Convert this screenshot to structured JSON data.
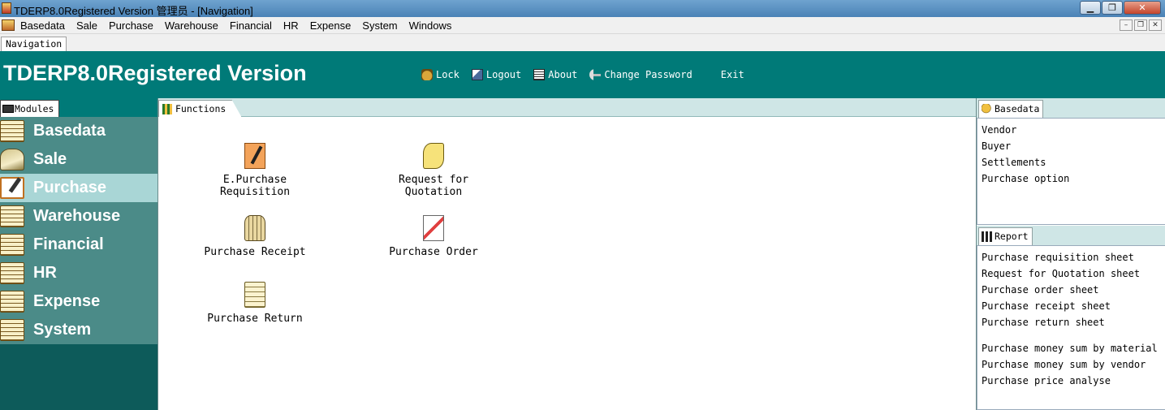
{
  "window": {
    "title": "TDERP8.0Registered Version 管理员 - [Navigation]",
    "minimize": "▁",
    "maximize": "❐",
    "close": "✕"
  },
  "menubar": {
    "items": [
      "Basedata",
      "Sale",
      "Purchase",
      "Warehouse",
      "Financial",
      "HR",
      "Expense",
      "System",
      "Windows"
    ],
    "mdi_minimize": "–",
    "mdi_restore": "❐",
    "mdi_close": "✕"
  },
  "navtab": {
    "label": "Navigation"
  },
  "banner": {
    "app_title": "TDERP8.0Registered Version",
    "tools": {
      "lock": "Lock",
      "logout": "Logout",
      "about": "About",
      "change_password": "Change Password",
      "exit": "Exit"
    }
  },
  "modules": {
    "tab_label": "Modules",
    "items": [
      "Basedata",
      "Sale",
      "Purchase",
      "Warehouse",
      "Financial",
      "HR",
      "Expense",
      "System"
    ],
    "active": "Purchase"
  },
  "functions": {
    "tab_label": "Functions",
    "items": [
      {
        "label": "E.Purchase Requisition"
      },
      {
        "label": "Request for Quotation"
      },
      {
        "label": "Purchase Receipt"
      },
      {
        "label": "Purchase Order"
      },
      {
        "label": "Purchase Return"
      }
    ]
  },
  "basedata_panel": {
    "tab_label": "Basedata",
    "items": [
      "Vendor",
      "Buyer",
      "Settlements",
      "Purchase option"
    ]
  },
  "report_panel": {
    "tab_label": "Report",
    "items": [
      "Purchase requisition sheet",
      "Request for Quotation sheet",
      "Purchase order sheet",
      "Purchase receipt sheet",
      "Purchase return sheet",
      "Purchase money sum by material",
      "Purchase money sum by vendor",
      "Purchase price analyse"
    ]
  },
  "colors": {
    "banner": "#007a78",
    "modules_bg": "#0d5b5a",
    "modules_list": "#4b8b88",
    "module_active": "#a9d6d6",
    "tab_strip": "#cfe6e6"
  }
}
